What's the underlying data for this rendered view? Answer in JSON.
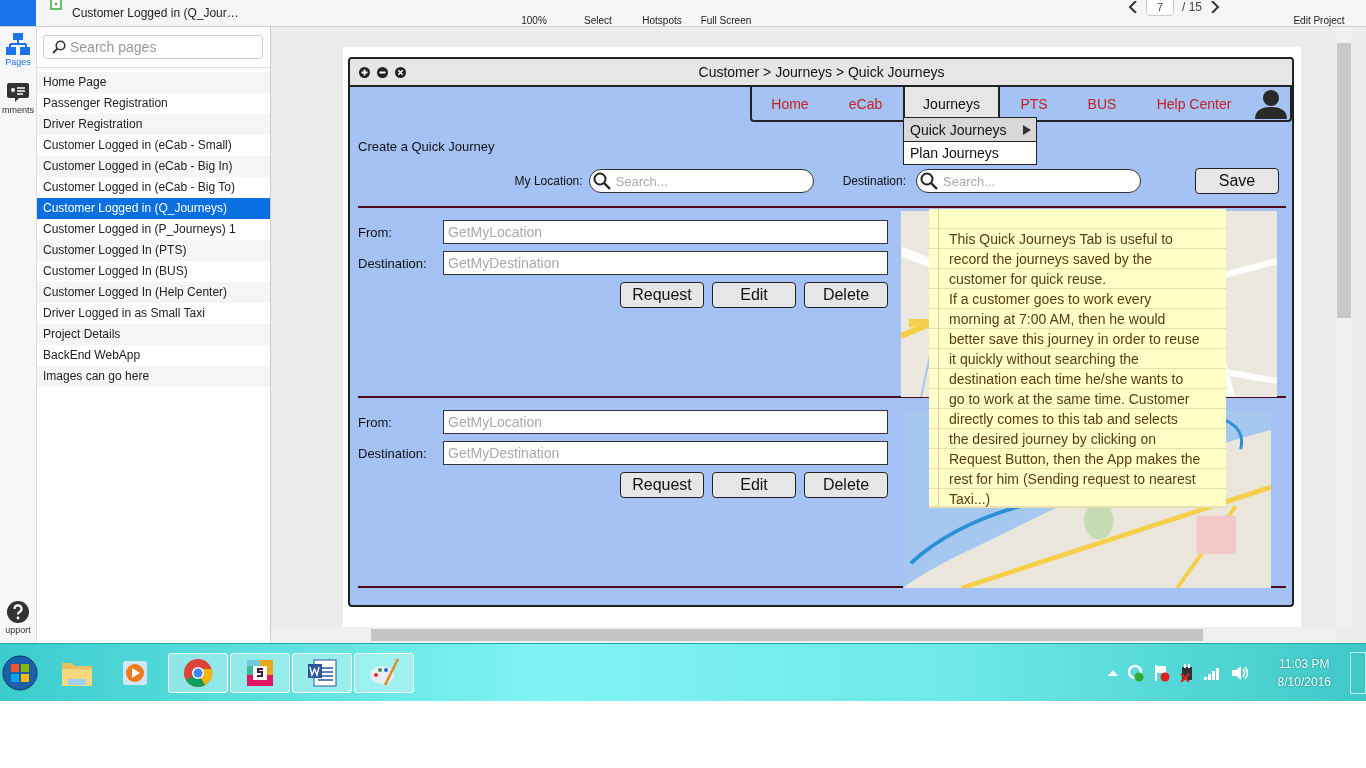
{
  "app_bar": {
    "document_title": "Customer Logged in (Q_Jour…",
    "tools": [
      {
        "label": "100%"
      },
      {
        "label": "Select"
      },
      {
        "label": "Hotspots"
      },
      {
        "label": "Full Screen"
      }
    ],
    "page_number": "7",
    "page_total": "/ 15",
    "edit_label": "Edit Project"
  },
  "rail": [
    {
      "label": "Pages",
      "kind": "pages",
      "selected": true
    },
    {
      "label": "mments",
      "kind": "comments",
      "selected": false
    },
    {
      "label": "upport",
      "kind": "support",
      "selected": false
    }
  ],
  "sidebar": {
    "search": {
      "placeholder": "Search pages"
    },
    "pages": [
      {
        "label": "Home Page",
        "selected": false
      },
      {
        "label": "Passenger Registration",
        "selected": false
      },
      {
        "label": "Driver Registration",
        "selected": false
      },
      {
        "label": "Customer Logged in (eCab - Small)",
        "selected": false
      },
      {
        "label": "Customer Logged in (eCab - Big In)",
        "selected": false
      },
      {
        "label": "Customer Logged in (eCab - Big To)",
        "selected": false
      },
      {
        "label": "Customer Logged in (Q_Journeys)",
        "selected": true
      },
      {
        "label": "Customer Logged in (P_Journeys) 1",
        "selected": false
      },
      {
        "label": "Customer Logged In (PTS)",
        "selected": false
      },
      {
        "label": "Customer Logged In (BUS)",
        "selected": false
      },
      {
        "label": "Customer Logged In (Help Center)",
        "selected": false
      },
      {
        "label": "Driver Logged in as Small Taxi",
        "selected": false
      },
      {
        "label": "Project Details",
        "selected": false
      },
      {
        "label": "BackEnd WebApp",
        "selected": false
      },
      {
        "label": "Images can go here",
        "selected": false
      }
    ]
  },
  "mockup": {
    "window_title": "Customer > Journeys > Quick Journeys",
    "nav": [
      {
        "label": "Home",
        "selected": false
      },
      {
        "label": "eCab",
        "selected": false
      },
      {
        "label": "Journeys",
        "selected": true
      },
      {
        "label": "PTS",
        "selected": false
      },
      {
        "label": "BUS",
        "selected": false
      },
      {
        "label": "Help Center",
        "selected": false
      }
    ],
    "dropdown": [
      {
        "label": "Quick Journeys",
        "selected": true,
        "submenu": true
      },
      {
        "label": "Plan Journeys",
        "selected": false,
        "submenu": false
      }
    ],
    "heading": "Create a Quick Journey",
    "my_location": {
      "label": "My Location:",
      "placeholder": "Search..."
    },
    "destination": {
      "label": "Destination:",
      "placeholder": "Search..."
    },
    "save": "Save",
    "journeys": [
      {
        "from_label": "From:",
        "from_placeholder": "GetMyLocation",
        "destination_label": "Destination:",
        "destination_placeholder": "GetMyDestination",
        "buttons": [
          "Request",
          "Edit",
          "Delete"
        ]
      },
      {
        "from_label": "From:",
        "from_placeholder": "GetMyLocation",
        "destination_label": "Destination:",
        "destination_placeholder": "GetMyDestination",
        "buttons": [
          "Request",
          "Edit",
          "Delete"
        ]
      }
    ],
    "note": [
      "This Quick Journeys Tab is useful to record the journeys saved by the customer for quick reuse.",
      "If a customer goes to work every morning at 7:00 AM, then he would better save this journey in order to reuse it quickly without searching the destination each time he/she wants to go to work at the same time. Customer directly comes to this tab and selects the desired journey by clicking on Request Button, then the App makes the rest for him (Sending request to nearest Taxi...)"
    ]
  },
  "taskbar": {
    "apps": [
      {
        "kind": "folder",
        "pinned": false
      },
      {
        "kind": "player",
        "pinned": false
      },
      {
        "kind": "chrome",
        "pinned": true
      },
      {
        "kind": "slack",
        "pinned": true
      },
      {
        "kind": "word",
        "pinned": true
      },
      {
        "kind": "paint",
        "pinned": true
      }
    ],
    "time": "11:03 PM",
    "date": "8/10/2016"
  }
}
